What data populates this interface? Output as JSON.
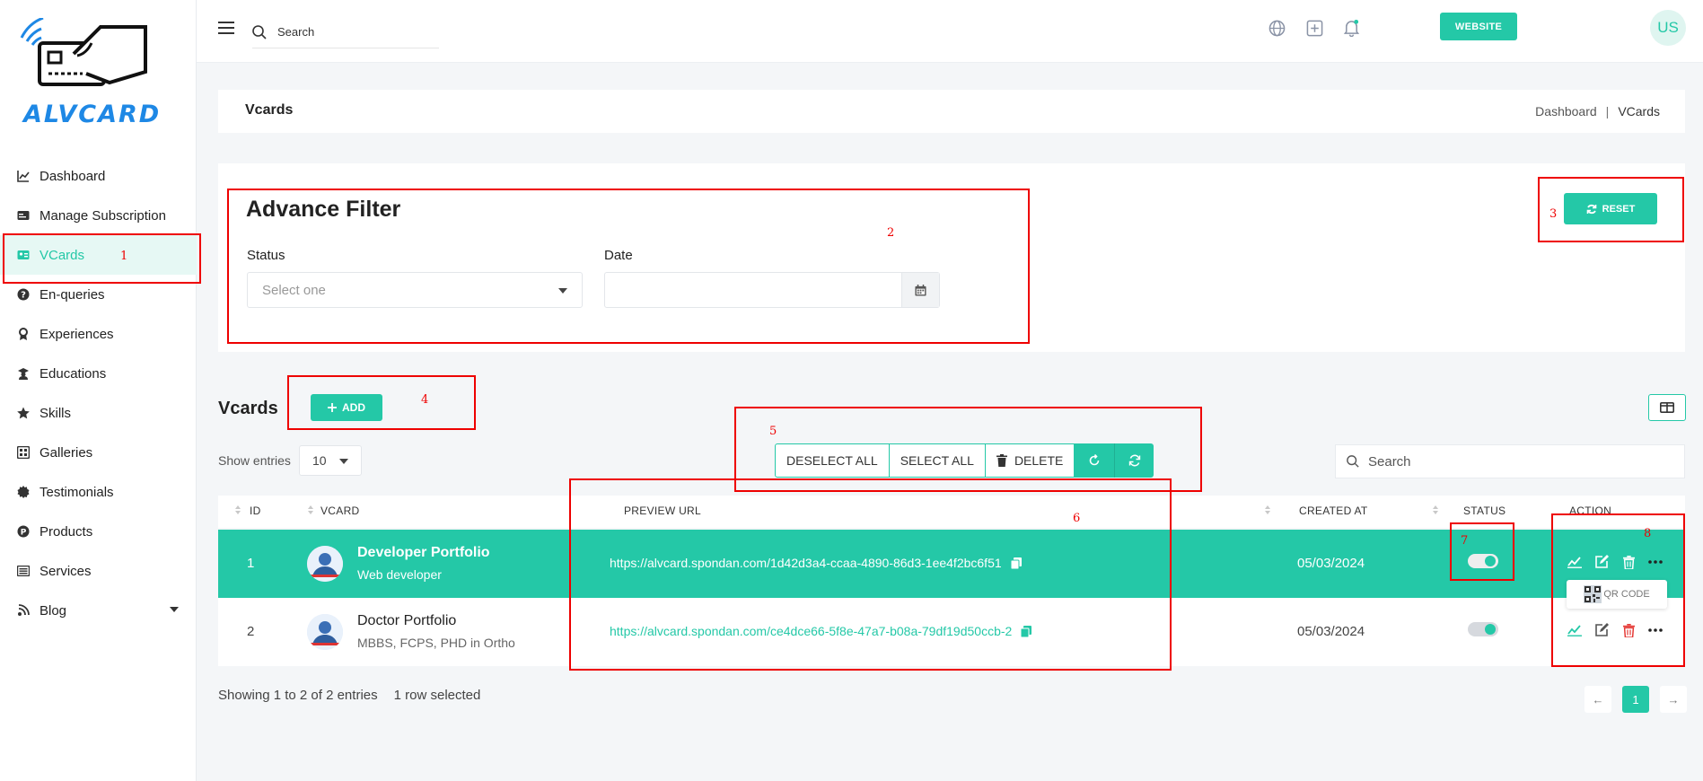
{
  "brand": {
    "logo_text": "ALVCARD",
    "accent": "#24c8a7",
    "logo_color": "#1e88e5"
  },
  "sidebar": {
    "items": [
      {
        "label": "Dashboard",
        "icon": "chart-line-icon"
      },
      {
        "label": "Manage Subscription",
        "icon": "card-icon"
      },
      {
        "label": "VCards",
        "icon": "id-card-icon",
        "active": true
      },
      {
        "label": "En-queries",
        "icon": "question-circle-icon"
      },
      {
        "label": "Experiences",
        "icon": "award-icon"
      },
      {
        "label": "Educations",
        "icon": "graduate-icon"
      },
      {
        "label": "Skills",
        "icon": "star-icon"
      },
      {
        "label": "Galleries",
        "icon": "gallery-icon"
      },
      {
        "label": "Testimonials",
        "icon": "badge-icon"
      },
      {
        "label": "Products",
        "icon": "product-icon"
      },
      {
        "label": "Services",
        "icon": "list-icon"
      },
      {
        "label": "Blog",
        "icon": "blog-icon"
      }
    ]
  },
  "topbar": {
    "search_placeholder": "Search",
    "website_label": "WEBSITE",
    "avatar_initials": "US"
  },
  "breadcrumb": {
    "title": "Vcards",
    "items": [
      "Dashboard",
      "VCards"
    ],
    "separator": "|"
  },
  "filter": {
    "title": "Advance Filter",
    "status_label": "Status",
    "status_placeholder": "Select one",
    "date_label": "Date",
    "reset_label": "RESET"
  },
  "list": {
    "title": "Vcards",
    "add_label": "ADD",
    "show_entries_label": "Show entries",
    "entries_value": "10",
    "search_placeholder": "Search",
    "bulk": {
      "deselect_all": "DESELECT ALL",
      "select_all": "SELECT ALL",
      "delete": "DELETE"
    },
    "columns": {
      "id": "ID",
      "vcard": "VCARD",
      "preview_url": "PREVIEW URL",
      "created_at": "CREATED AT",
      "status": "STATUS",
      "action": "ACTION"
    },
    "rows": [
      {
        "id": "1",
        "name": "Developer Portfolio",
        "subtitle": "Web developer",
        "url": "https://alvcard.spondan.com/1d42d3a4-ccaa-4890-86d3-1ee4f2bc6f51",
        "created_at": "05/03/2024",
        "selected": true
      },
      {
        "id": "2",
        "name": "Doctor Portfolio",
        "subtitle": "MBBS, FCPS, PHD in Ortho",
        "url": "https://alvcard.spondan.com/ce4dce66-5f8e-47a7-b08a-79df19d50ccb-2",
        "created_at": "05/03/2024",
        "selected": false
      }
    ],
    "qr_popup_label": "QR CODE",
    "footer": {
      "showing": "Showing 1 to 2 of 2 entries",
      "selected": "1 row selected"
    },
    "pager": {
      "prev": "←",
      "current": "1",
      "next": "→"
    }
  },
  "annotations": [
    "1",
    "2",
    "3",
    "4",
    "5",
    "6",
    "7",
    "8"
  ]
}
